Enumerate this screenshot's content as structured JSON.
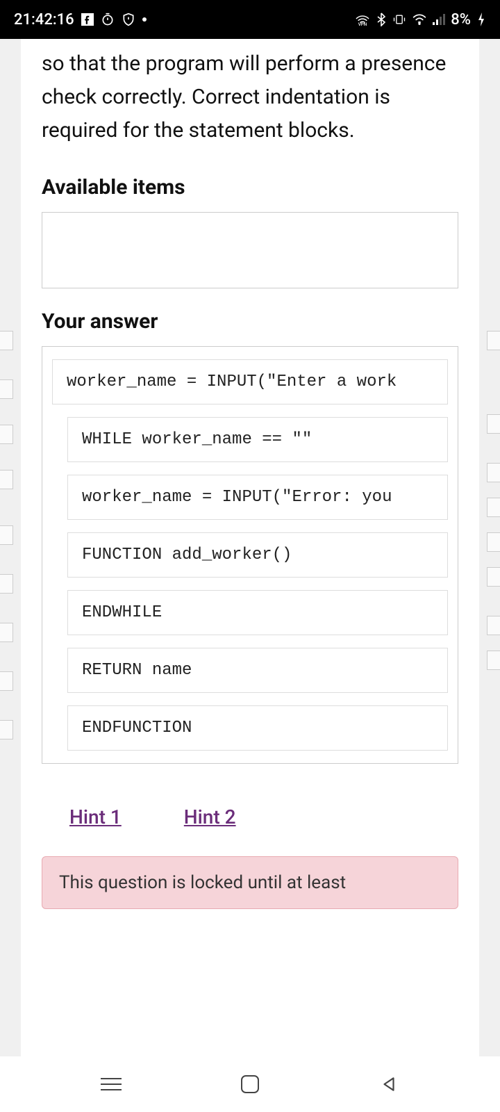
{
  "status": {
    "time": "21:42:16",
    "battery": "8%"
  },
  "intro": "so that the program will perform a presence check correctly. Correct indentation is required for the statement blocks.",
  "sections": {
    "available": "Available items",
    "answer": "Your answer"
  },
  "answer_items": [
    {
      "text": "worker_name = INPUT(\"Enter a work",
      "indent": false
    },
    {
      "text": "WHILE worker_name == \"\"",
      "indent": true
    },
    {
      "text": "worker_name = INPUT(\"Error: you",
      "indent": true
    },
    {
      "text": "FUNCTION add_worker()",
      "indent": true
    },
    {
      "text": "ENDWHILE",
      "indent": true
    },
    {
      "text": "RETURN name",
      "indent": true
    },
    {
      "text": "ENDFUNCTION",
      "indent": true
    }
  ],
  "hints": {
    "h1": "Hint 1",
    "h2": "Hint 2"
  },
  "locked": "This question is locked until at least"
}
